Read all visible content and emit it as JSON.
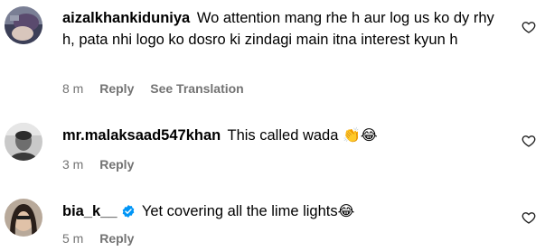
{
  "comments": [
    {
      "username": "aizalkhankiduniya",
      "text": "Wo attention mang rhe h aur log us ko dy rhy h, pata nhi logo ko dosro ki zindagi main itna interest kyun h",
      "emoji": "",
      "verified": false,
      "time": "8 m",
      "reply_label": "Reply",
      "translation_label": "See Translation",
      "like_icon": "heart-outline-icon"
    },
    {
      "username": "mr.malaksaad547khan",
      "text": "This called wada",
      "emoji": "👏😂",
      "verified": false,
      "time": "3 m",
      "reply_label": "Reply",
      "like_icon": "heart-outline-icon"
    },
    {
      "username": "bia_k__",
      "text": "Yet covering all the lime lights",
      "emoji": "😂",
      "verified": true,
      "verified_icon": "verified-badge-icon",
      "verified_color": "#0095f6",
      "time": "5 m",
      "reply_label": "Reply",
      "like_icon": "heart-outline-icon"
    }
  ],
  "colors": {
    "text": "#000000",
    "meta": "#737373",
    "verified": "#0095f6"
  }
}
